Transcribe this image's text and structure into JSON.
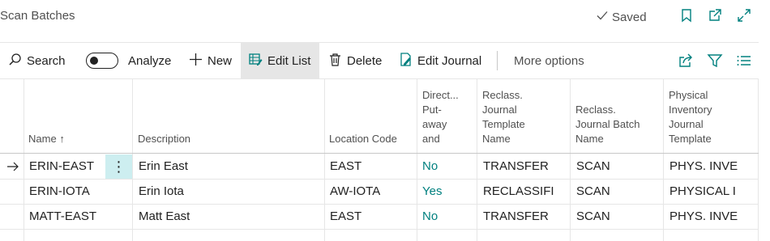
{
  "page": {
    "title": "Scan Batches",
    "saved_label": "Saved"
  },
  "actions": {
    "search": "Search",
    "analyze": "Analyze",
    "new": "New",
    "edit_list": "Edit List",
    "delete": "Delete",
    "edit_journal": "Edit Journal",
    "more_options": "More options"
  },
  "columns": {
    "name": "Name",
    "description": "Description",
    "location_code": "Location Code",
    "directed_putaway": [
      "Direct...",
      "Put-",
      "away",
      "and"
    ],
    "reclass_template": [
      "Reclass.",
      "Journal",
      "Template",
      "Name"
    ],
    "reclass_batch": [
      "Reclass.",
      "Journal Batch",
      "Name"
    ],
    "physical_template": [
      "Physical",
      "Inventory",
      "Journal",
      "Template"
    ]
  },
  "rows": [
    {
      "name": "ERIN-EAST",
      "description": "Erin East",
      "location": "EAST",
      "directed": "No",
      "reclass_template": "TRANSFER",
      "reclass_batch": "SCAN",
      "physical_template": "PHYS. INVE"
    },
    {
      "name": "ERIN-IOTA",
      "description": "Erin Iota",
      "location": "AW-IOTA",
      "directed": "Yes",
      "reclass_template": "RECLASSIFI",
      "reclass_batch": "SCAN",
      "physical_template": "PHYSICAL I"
    },
    {
      "name": "MATT-EAST",
      "description": "Matt East",
      "location": "EAST",
      "directed": "No",
      "reclass_template": "TRANSFER",
      "reclass_batch": "SCAN",
      "physical_template": "PHYS. INVE"
    }
  ],
  "colors": {
    "accent": "#00807f",
    "selected_cell": "#cdeef0",
    "active_action": "#e6e6e6"
  }
}
